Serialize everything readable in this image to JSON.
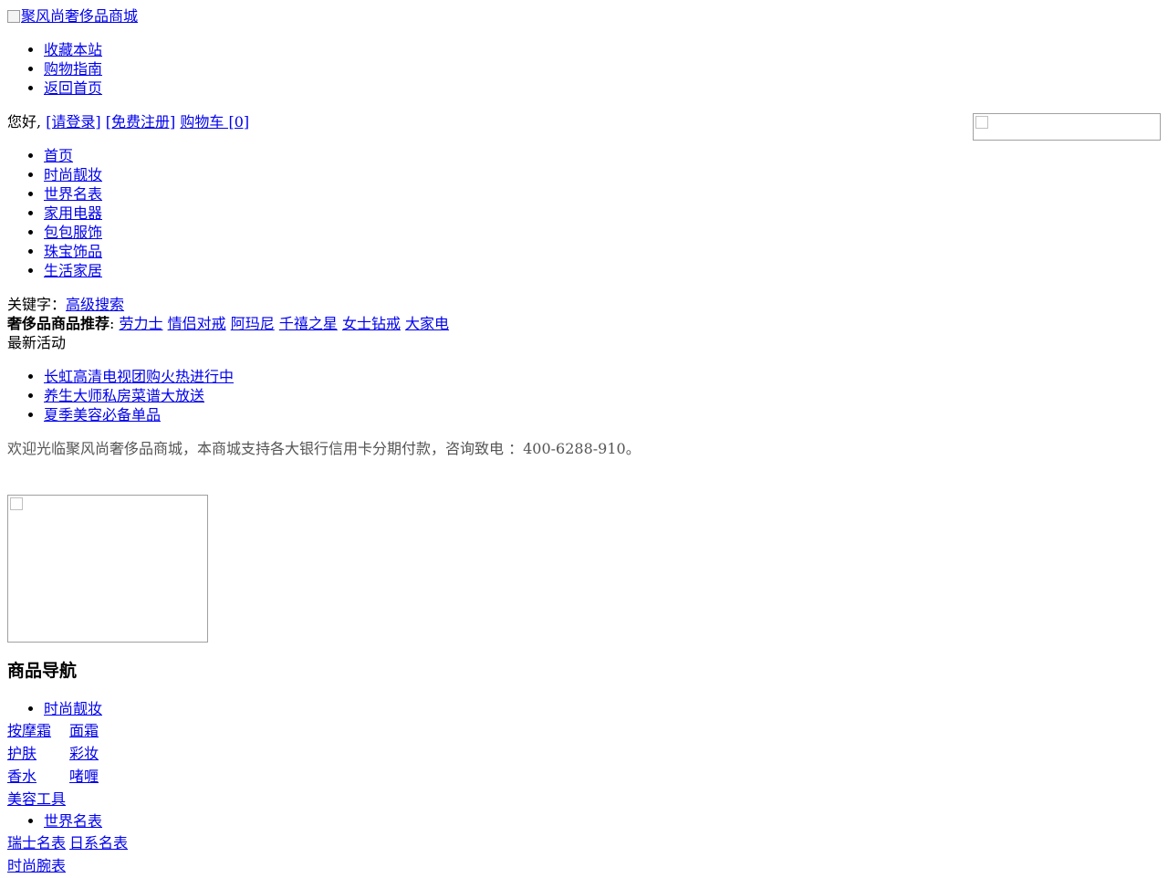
{
  "logo": {
    "alt": "聚风尚奢侈品商城"
  },
  "top_links": [
    "收藏本站",
    "购物指南",
    "返回首页"
  ],
  "userbar": {
    "greeting": "您好,",
    "login": "[请登录]",
    "register": "[免费注册]",
    "cart": "购物车 [0]"
  },
  "main_nav": [
    "首页",
    "时尚靓妆",
    "世界名表",
    "家用电器",
    "包包服饰",
    "珠宝饰品",
    "生活家居"
  ],
  "search": {
    "label": "关键字：",
    "advanced": "高级搜索"
  },
  "hot": {
    "label": "奢侈品商品推荐",
    "sep": ":",
    "items": [
      "劳力士",
      "情侣对戒",
      "阿玛尼",
      "千禧之星",
      "女士钻戒",
      "大家电"
    ]
  },
  "news": {
    "title": "最新活动",
    "items": [
      "长虹高清电视团购火热进行中",
      "养生大师私房菜谱大放送",
      "夏季美容必备单品"
    ]
  },
  "welcome": "欢迎光临聚风尚奢侈品商城，本商城支持各大银行信用卡分期付款，咨询致电 ：400-6288-910。",
  "catnav": {
    "title": "商品导航",
    "categories": [
      {
        "name": "时尚靓妆",
        "subs": [
          [
            "按摩霜",
            "面霜"
          ],
          [
            "护肤",
            "彩妆"
          ],
          [
            "香水",
            "啫喱"
          ],
          [
            "美容工具",
            ""
          ]
        ]
      },
      {
        "name": "世界名表",
        "subs": [
          [
            "瑞士名表",
            "日系名表"
          ],
          [
            "时尚腕表",
            ""
          ]
        ]
      }
    ]
  }
}
